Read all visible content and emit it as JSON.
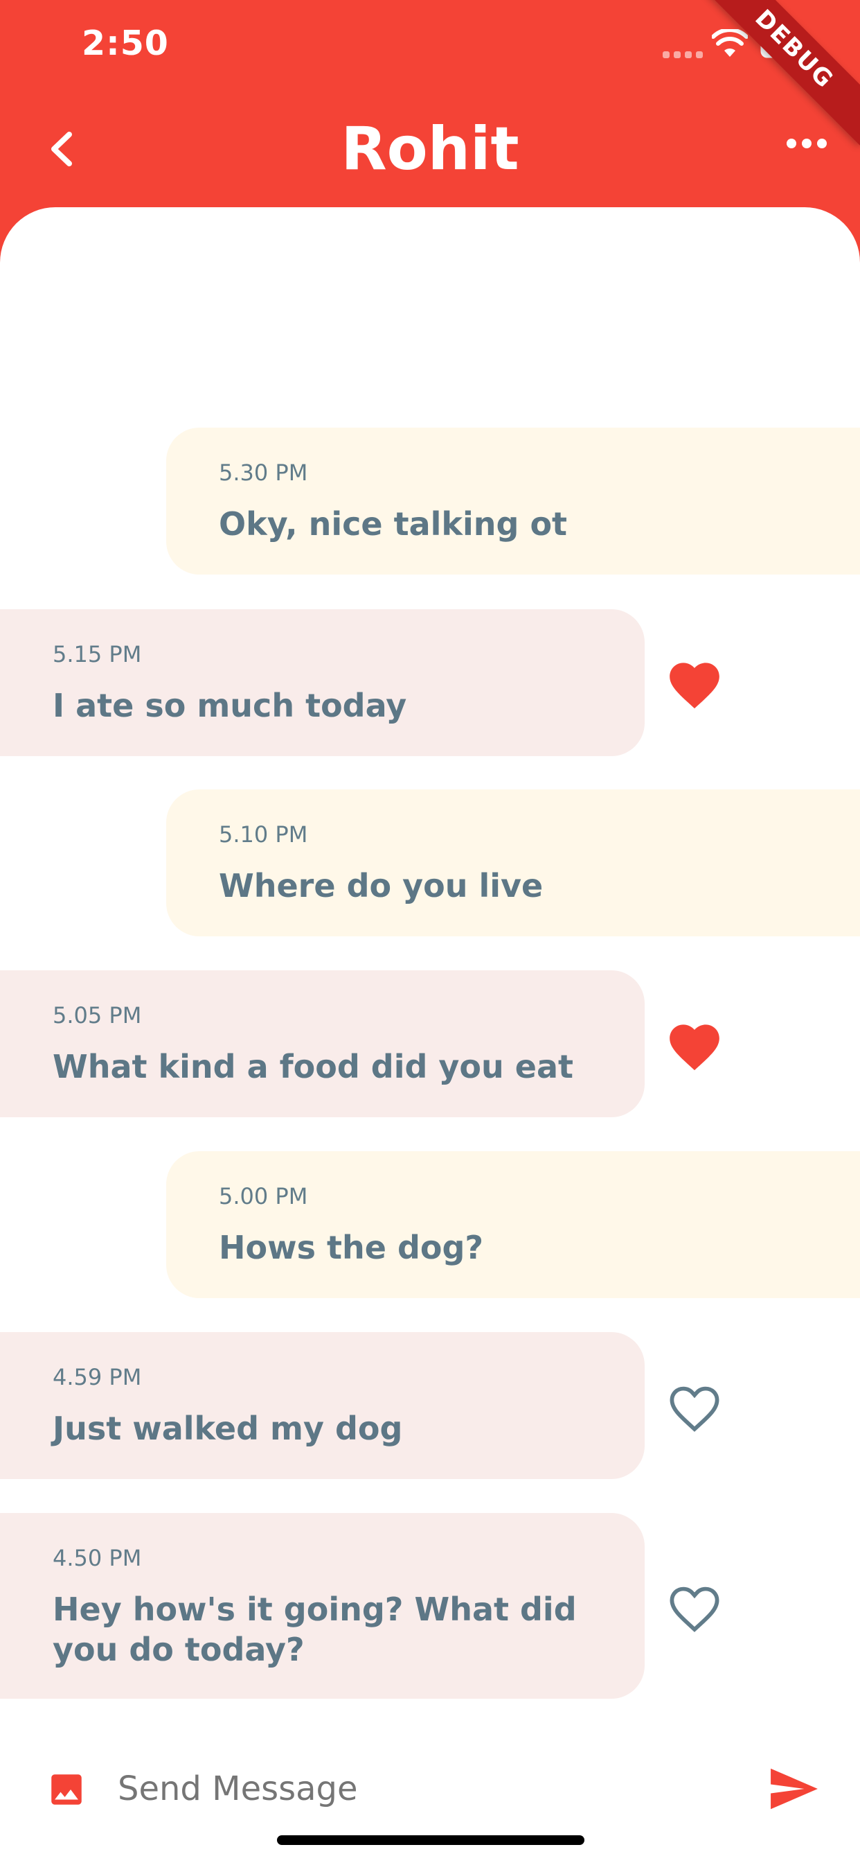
{
  "status_bar": {
    "time": "2:50"
  },
  "debug_banner": "DEBUG",
  "header": {
    "title": "Rohit"
  },
  "messages": [
    {
      "direction": "sent",
      "time": "5.30 PM",
      "text": "Oky, nice talking ot"
    },
    {
      "direction": "received",
      "time": "5.15 PM",
      "text": "I ate so much today",
      "liked": true
    },
    {
      "direction": "sent",
      "time": "5.10 PM",
      "text": "Where do you live"
    },
    {
      "direction": "received",
      "time": "5.05 PM",
      "text": "What kind a food did you eat",
      "liked": true
    },
    {
      "direction": "sent",
      "time": "5.00 PM",
      "text": "Hows the dog?"
    },
    {
      "direction": "received",
      "time": "4.59 PM",
      "text": "Just walked my dog",
      "liked": false
    },
    {
      "direction": "received",
      "time": "4.50 PM",
      "text": "Hey how's it going? What did you do today?",
      "liked": false
    }
  ],
  "composer": {
    "placeholder": "Send Message",
    "value": ""
  },
  "colors": {
    "accent": "#f44336",
    "sent_bubble": "#fff8e9",
    "received_bubble": "#f9ecea",
    "message_text": "#5d7786",
    "heart_filled": "#f44336",
    "heart_outline": "#617c8a"
  },
  "icons": {
    "back": "chevron-left-icon",
    "more": "more-horizontal-icon",
    "like_filled": "heart-filled-icon",
    "like_outline": "heart-outline-icon",
    "attach_image": "image-icon",
    "send": "send-icon",
    "wifi": "wifi-icon",
    "battery": "battery-icon"
  }
}
